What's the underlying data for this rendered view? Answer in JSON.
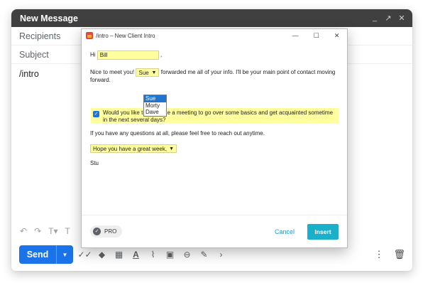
{
  "compose": {
    "title": "New Message",
    "minimize": "_",
    "popout": "↗",
    "close": "✕",
    "recipients_placeholder": "Recipients",
    "subject_placeholder": "Subject",
    "body_text": "/intro",
    "send_label": "Send"
  },
  "dialog": {
    "title": "/intro – New Client Intro",
    "greeting": "Hi",
    "name_value": "Bill",
    "comma": ",",
    "nice_to_meet": "Nice to meet you!",
    "referrer_selected": "Sue",
    "forwarded_text": "forwarded me all of your info. I'll be your main point of contact moving",
    "forward_word": "forward.",
    "referrer_options": [
      "Sue",
      "Morty",
      "Dave"
    ],
    "meeting_text": "Would you like to schedule a meeting to go over some basics and get acquainted sometime in the next several days?",
    "meeting_checked": true,
    "questions_text": "If you have any questions at all, please feel free to reach out anytime.",
    "closing_selected": "Hope you have a great week,",
    "signature": "Stu",
    "pro_label": "PRO",
    "cancel_label": "Cancel",
    "insert_label": "Insert"
  },
  "colors": {
    "send_blue": "#1a73e8",
    "insert_teal": "#1ab0c9",
    "highlight_yellow": "#ffff9e",
    "header_dark": "#404040"
  }
}
